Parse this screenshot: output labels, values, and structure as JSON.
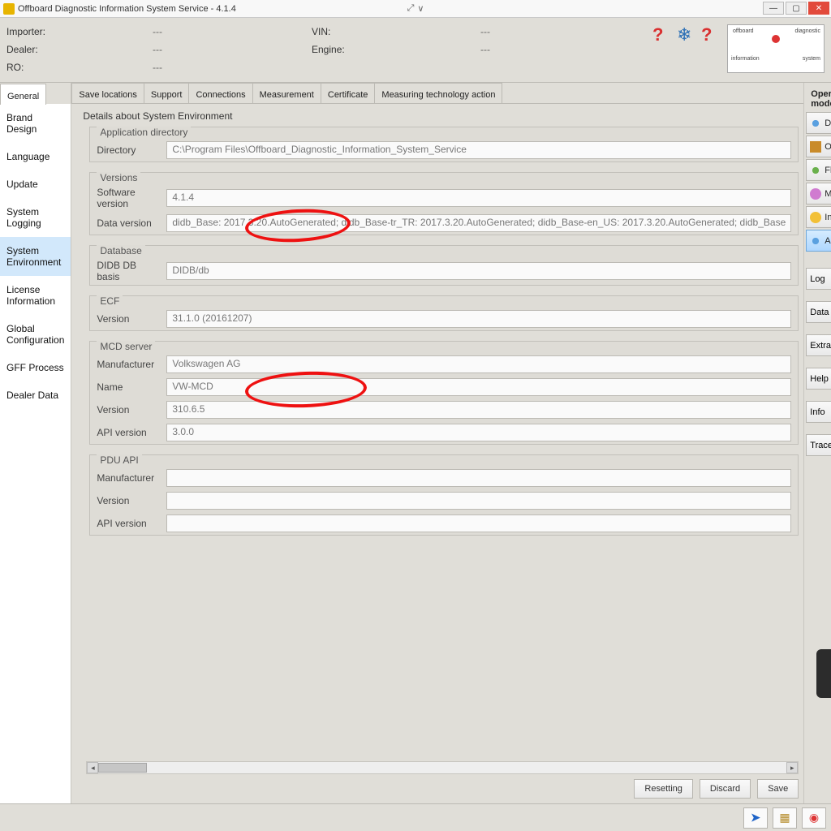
{
  "window": {
    "title": "Offboard Diagnostic Information System Service - 4.1.4"
  },
  "header": {
    "importer_label": "Importer:",
    "dealer_label": "Dealer:",
    "ro_label": "RO:",
    "vin_label": "VIN:",
    "engine_label": "Engine:",
    "dash": "---"
  },
  "tabs": {
    "general": "General",
    "save_locations": "Save locations",
    "support": "Support",
    "connections": "Connections",
    "measurement": "Measurement",
    "certificate": "Certificate",
    "measuring_tech": "Measuring technology action"
  },
  "sidebar": {
    "items": [
      "Brand Design",
      "Language",
      "Update",
      "System Logging",
      "System Environment",
      "License Information",
      "Global Configuration",
      "GFF Process",
      "Dealer Data"
    ],
    "selected_index": 4
  },
  "details": {
    "title": "Details about System Environment",
    "appdir": {
      "legend": "Application directory",
      "directory_label": "Directory",
      "directory_value": "C:\\Program Files\\Offboard_Diagnostic_Information_System_Service"
    },
    "versions": {
      "legend": "Versions",
      "software_label": "Software version",
      "software_value": "4.1.4",
      "data_label": "Data version",
      "data_value": "didb_Base: 2017.3.20.AutoGenerated; didb_Base-tr_TR: 2017.3.20.AutoGenerated; didb_Base-en_US: 2017.3.20.AutoGenerated; didb_Base"
    },
    "database": {
      "legend": "Database",
      "basis_label": "DIDB DB basis",
      "basis_value": "DIDB/db"
    },
    "ecf": {
      "legend": "ECF",
      "version_label": "Version",
      "version_value": "31.1.0 (20161207)"
    },
    "mcd": {
      "legend": "MCD server",
      "manufacturer_label": "Manufacturer",
      "manufacturer_value": "Volkswagen AG",
      "name_label": "Name",
      "name_value": "VW-MCD",
      "version_label": "Version",
      "version_value": "310.6.5",
      "api_label": "API version",
      "api_value": "3.0.0"
    },
    "pdu": {
      "legend": "PDU API",
      "manufacturer_label": "Manufacturer",
      "manufacturer_value": "",
      "version_label": "Version",
      "version_value": "",
      "api_label": "API version",
      "api_value": ""
    }
  },
  "actions": {
    "resetting": "Resetting",
    "discard": "Discard",
    "save": "Save"
  },
  "right": {
    "title": "Operating modes",
    "diagnosis": "Diagnosis",
    "obd": "OBD",
    "flash": "Flash",
    "measurement": "Measurement",
    "info": "Info",
    "admin": "Admin",
    "log": "Log",
    "data": "Data",
    "extras": "Extras",
    "help": "Help",
    "info2": "Info",
    "trace": "Trace"
  }
}
